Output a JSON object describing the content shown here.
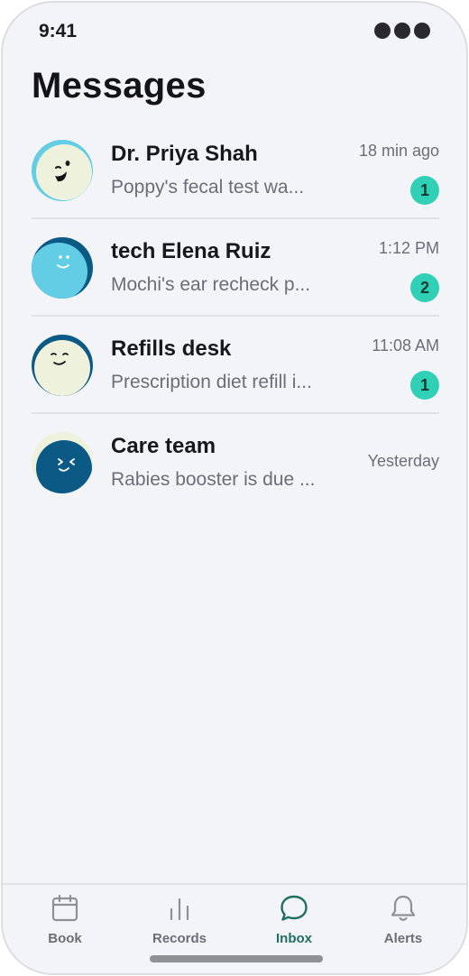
{
  "status_bar": {
    "time": "9:41"
  },
  "page": {
    "title": "Messages"
  },
  "threads": [
    {
      "name": "Dr. Priya Shah",
      "preview": "Poppy's fecal test wa...",
      "time": "18 min ago",
      "unread": "1",
      "avatar_icon": "winking-face-avatar"
    },
    {
      "name": "tech Elena Ruiz",
      "preview": "Mochi's ear recheck p...",
      "time": "1:12 PM",
      "unread": "2",
      "avatar_icon": "smiling-face-avatar"
    },
    {
      "name": "Refills desk",
      "preview": "Prescription diet refill i...",
      "time": "11:08 AM",
      "unread": "1",
      "avatar_icon": "content-face-avatar"
    },
    {
      "name": "Care team",
      "preview": "Rabies booster is due ...",
      "time": "Yesterday",
      "unread": "",
      "avatar_icon": "squinting-face-avatar"
    }
  ],
  "tabs": [
    {
      "label": "Book",
      "icon": "calendar-icon",
      "active": false
    },
    {
      "label": "Records",
      "icon": "bar-chart-icon",
      "active": false
    },
    {
      "label": "Inbox",
      "icon": "chat-bubble-icon",
      "active": true
    },
    {
      "label": "Alerts",
      "icon": "bell-icon",
      "active": false
    }
  ],
  "colors": {
    "accent": "#2fd0b6",
    "active_tab": "#1f6e63",
    "background": "#f3f4f7",
    "avatar_cream": "#eef2dc",
    "avatar_sky": "#63cde5",
    "avatar_navy": "#0b5a86"
  }
}
